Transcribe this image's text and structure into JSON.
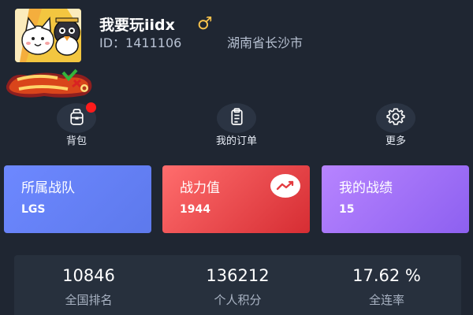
{
  "profile": {
    "username": "我要玩iidx",
    "gender_symbol": "♂",
    "id_text": "ID：1411106",
    "location": "湖南省长沙市",
    "avatar_icon": "chibi-characters-avatar",
    "badge_logo_text": "Critical Alcohol"
  },
  "actions": [
    {
      "label": "背包",
      "icon": "backpack-icon",
      "has_notification": true
    },
    {
      "label": "我的订单",
      "icon": "order-list-icon",
      "has_notification": false
    },
    {
      "label": "更多",
      "icon": "gear-icon",
      "has_notification": false
    }
  ],
  "cards": [
    {
      "title": "所属战队",
      "value": "LGS"
    },
    {
      "title": "战力值",
      "value": "1944",
      "icon": "trend-line-icon"
    },
    {
      "title": "我的战绩",
      "value": "15"
    }
  ],
  "stats": [
    {
      "value": "10846",
      "label": "全国排名"
    },
    {
      "value": "136212",
      "label": "个人积分"
    },
    {
      "value": "17.62 %",
      "label": "全连率"
    }
  ],
  "colors": {
    "background": "#1f2632",
    "team_card": "#6d88ff",
    "power_card": "#e64a4f",
    "record_card": "#a877fb",
    "gender": "#f6c24d",
    "notification_dot": "#ff1b1b"
  }
}
